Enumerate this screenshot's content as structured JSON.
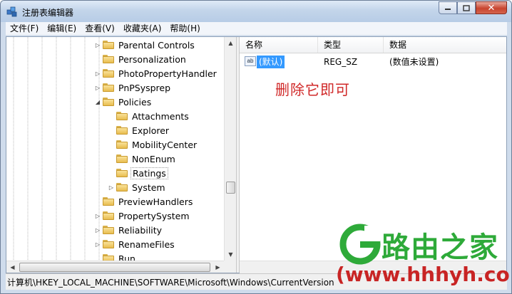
{
  "window": {
    "title": "注册表编辑器",
    "close_glyph": "✕"
  },
  "menu": [
    "文件(F)",
    "编辑(E)",
    "查看(V)",
    "收藏夹(A)",
    "帮助(H)"
  ],
  "tree": {
    "items": [
      {
        "label": "Parental Controls",
        "expander": "▷"
      },
      {
        "label": "Personalization",
        "expander": ""
      },
      {
        "label": "PhotoPropertyHandler",
        "expander": "▷"
      },
      {
        "label": "PnPSysprep",
        "expander": "▷"
      },
      {
        "label": "Policies",
        "expander": "◢"
      },
      {
        "label": "Attachments",
        "expander": ""
      },
      {
        "label": "Explorer",
        "expander": ""
      },
      {
        "label": "MobilityCenter",
        "expander": ""
      },
      {
        "label": "NonEnum",
        "expander": ""
      },
      {
        "label": "Ratings",
        "expander": ""
      },
      {
        "label": "System",
        "expander": "▷"
      },
      {
        "label": "PreviewHandlers",
        "expander": ""
      },
      {
        "label": "PropertySystem",
        "expander": "▷"
      },
      {
        "label": "Reliability",
        "expander": "▷"
      },
      {
        "label": "RenameFiles",
        "expander": "▷"
      },
      {
        "label": "Run",
        "expander": ""
      }
    ]
  },
  "values": {
    "headers": {
      "name": "名称",
      "type": "类型",
      "data": "数据"
    },
    "rows": [
      {
        "icon": "ab",
        "name": "(默认)",
        "type": "REG_SZ",
        "data": "(数值未设置)"
      }
    ],
    "annotation": "删除它即可"
  },
  "status": "计算机\\HKEY_LOCAL_MACHINE\\SOFTWARE\\Microsoft\\Windows\\CurrentVersion",
  "watermark": {
    "brand": "路由之家",
    "url": "(www.hhhyh.com)"
  },
  "colors": {
    "selection": "#3399ff",
    "annotation": "#d02828",
    "brand_green": "#2eaa39",
    "brand_red": "#c82424"
  }
}
